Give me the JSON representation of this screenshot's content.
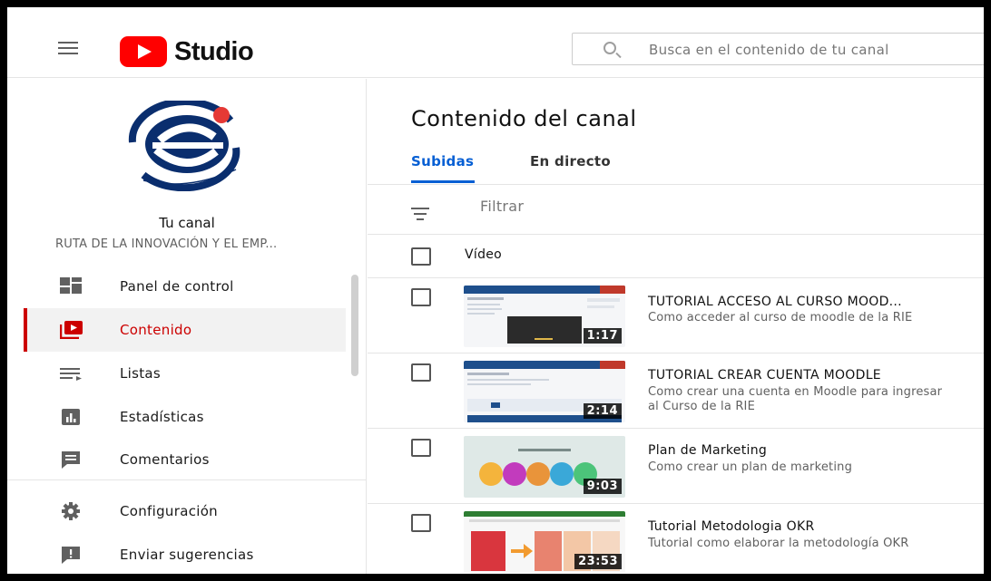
{
  "header": {
    "logo_text": "Studio",
    "search_placeholder": "Busca en el contenido de tu canal"
  },
  "sidebar": {
    "channel_title": "Tu canal",
    "channel_name": "RUTA DE LA INNOVACIÓN Y EL EMP...",
    "items": [
      {
        "label": "Panel de control",
        "icon": "dashboard-icon"
      },
      {
        "label": "Contenido",
        "icon": "content-icon",
        "active": true
      },
      {
        "label": "Listas",
        "icon": "playlist-icon"
      },
      {
        "label": "Estadísticas",
        "icon": "analytics-icon"
      },
      {
        "label": "Comentarios",
        "icon": "comments-icon"
      },
      {
        "label": "Configuración",
        "icon": "settings-icon"
      },
      {
        "label": "Enviar sugerencias",
        "icon": "feedback-icon"
      }
    ]
  },
  "main": {
    "page_title": "Contenido del canal",
    "tabs": [
      {
        "label": "Subidas",
        "active": true
      },
      {
        "label": "En directo",
        "active": false
      }
    ],
    "filter_label": "Filtrar",
    "column_header": "Vídeo",
    "videos": [
      {
        "title": "TUTORIAL ACCESO AL CURSO MOOD...",
        "description": "Como acceder al curso de moodle de la RIE",
        "duration": "1:17"
      },
      {
        "title": "TUTORIAL CREAR CUENTA MOODLE",
        "description": "Como crear una cuenta en Moodle para ingresar al Curso de la RIE",
        "duration": "2:14"
      },
      {
        "title": "Plan de Marketing",
        "description": "Como crear un plan de marketing",
        "duration": "9:03"
      },
      {
        "title": "Tutorial Metodologia OKR",
        "description": "Tutorial como elaborar la metodología OKR",
        "duration": "23:53"
      }
    ]
  },
  "colors": {
    "accent_red": "#cc0000",
    "accent_blue": "#065fd4",
    "brand_red": "#ff0000"
  }
}
